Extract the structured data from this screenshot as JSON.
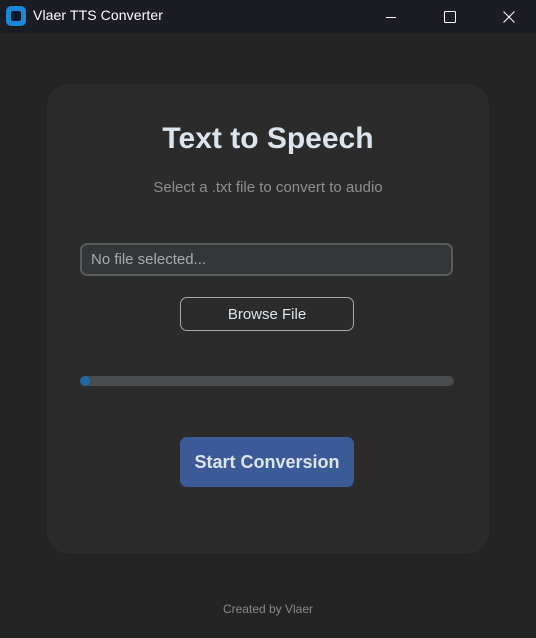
{
  "window": {
    "title": "Vlaer TTS Converter",
    "icon": "app-logo-icon",
    "controls": {
      "minimize_icon": "minimize-icon",
      "maximize_icon": "maximize-icon",
      "close_icon": "close-icon"
    }
  },
  "main": {
    "heading": "Text to Speech",
    "subheading": "Select a .txt file to convert to audio",
    "file_input": {
      "placeholder": "No file selected...",
      "value": ""
    },
    "browse_button_label": "Browse File",
    "progress": {
      "value": 0.0,
      "fill_color": "#1f6aa5"
    },
    "start_button_label": "Start Conversion"
  },
  "footer": {
    "credit": "Created by Vlaer"
  },
  "colors": {
    "background": "#242424",
    "card": "#2b2b2b",
    "accent": "#1e88d8",
    "primary_button": "#3d5a98"
  }
}
